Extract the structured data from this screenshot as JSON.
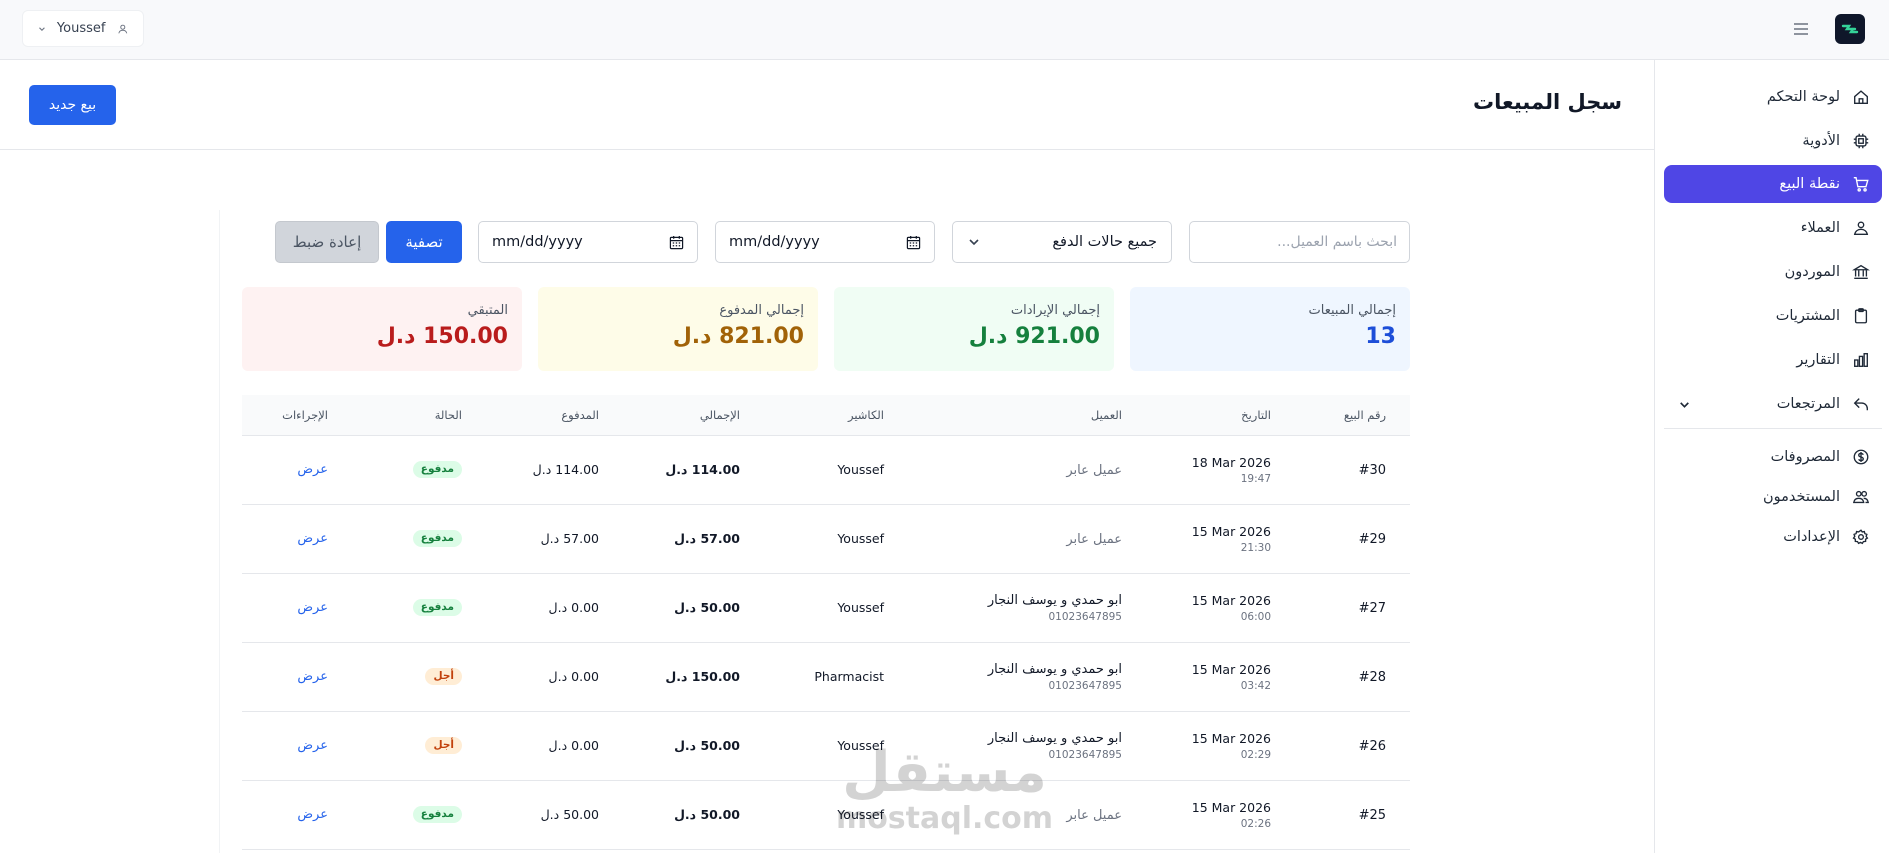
{
  "user": {
    "name": "Youssef"
  },
  "colors": {
    "primary": "#2563eb",
    "sidebar_active": "#4f46e5"
  },
  "sidebar": {
    "items": [
      {
        "label": "لوحة التحكم",
        "icon": "home-icon"
      },
      {
        "label": "الأدوية",
        "icon": "pill-icon"
      },
      {
        "label": "نقطة البيع",
        "icon": "cart-icon",
        "active": true
      },
      {
        "label": "العملاء",
        "icon": "users-icon"
      },
      {
        "label": "الموردون",
        "icon": "building-icon"
      },
      {
        "label": "المشتريات",
        "icon": "clipboard-icon"
      },
      {
        "label": "التقارير",
        "icon": "chart-icon"
      },
      {
        "label": "المرتجعات",
        "icon": "return-icon",
        "has_submenu": true
      },
      {
        "label": "المصروفات",
        "icon": "dollar-icon"
      },
      {
        "label": "المستخدمون",
        "icon": "user-group-icon"
      },
      {
        "label": "الإعدادات",
        "icon": "gear-icon"
      }
    ]
  },
  "header": {
    "title": "سجل المبيعات",
    "new_sale_label": "بيع جديد"
  },
  "filters": {
    "search_placeholder": "ابحث باسم العميل...",
    "status_selected": "جميع حالات الدفع",
    "date_from_placeholder": "mm/dd/yyyy",
    "date_to_placeholder": "mm/dd/yyyy",
    "filter_label": "تصفية",
    "reset_label": "إعادة ضبط"
  },
  "stats": [
    {
      "label": "إجمالي المبيعات",
      "value": "13"
    },
    {
      "label": "إجمالي الإيرادات",
      "value": "921.00 د.ل"
    },
    {
      "label": "إجمالي المدفوع",
      "value": "821.00 د.ل"
    },
    {
      "label": "المتبقي",
      "value": "150.00 د.ل"
    }
  ],
  "table": {
    "columns": [
      "رقم البيع",
      "التاريخ",
      "العميل",
      "الكاشير",
      "الإجمالي",
      "المدفوع",
      "الحالة",
      "الإجراءات"
    ],
    "rows": [
      {
        "id": "#30",
        "date": "18 Mar 2026",
        "time": "19:47",
        "customer": "عميل عابر",
        "phone": "",
        "cashier": "Youssef",
        "total": "114.00 د.ل",
        "paid": "114.00 د.ل",
        "status": "مدفوع",
        "status_type": "paid",
        "action": "عرض"
      },
      {
        "id": "#29",
        "date": "15 Mar 2026",
        "time": "21:30",
        "customer": "عميل عابر",
        "phone": "",
        "cashier": "Youssef",
        "total": "57.00 د.ل",
        "paid": "57.00 د.ل",
        "status": "مدفوع",
        "status_type": "paid",
        "action": "عرض"
      },
      {
        "id": "#27",
        "date": "15 Mar 2026",
        "time": "06:00",
        "customer": "ابو حمدي و يوسف النجار",
        "phone": "01023647895",
        "cashier": "Youssef",
        "total": "50.00 د.ل",
        "paid": "0.00 د.ل",
        "status": "مدفوع",
        "status_type": "paid",
        "action": "عرض"
      },
      {
        "id": "#28",
        "date": "15 Mar 2026",
        "time": "03:42",
        "customer": "ابو حمدي و يوسف النجار",
        "phone": "01023647895",
        "cashier": "Pharmacist",
        "total": "150.00 د.ل",
        "paid": "0.00 د.ل",
        "status": "أجل",
        "status_type": "credit",
        "action": "عرض"
      },
      {
        "id": "#26",
        "date": "15 Mar 2026",
        "time": "02:29",
        "customer": "ابو حمدي و يوسف النجار",
        "phone": "01023647895",
        "cashier": "Youssef",
        "total": "50.00 د.ل",
        "paid": "0.00 د.ل",
        "status": "أجل",
        "status_type": "credit",
        "action": "عرض"
      },
      {
        "id": "#25",
        "date": "15 Mar 2026",
        "time": "02:26",
        "customer": "عميل عابر",
        "phone": "",
        "cashier": "Youssef",
        "total": "50.00 د.ل",
        "paid": "50.00 د.ل",
        "status": "مدفوع",
        "status_type": "paid",
        "action": "عرض"
      }
    ]
  },
  "watermark": {
    "line1": "مستقل",
    "line2": "mostaql.com"
  }
}
